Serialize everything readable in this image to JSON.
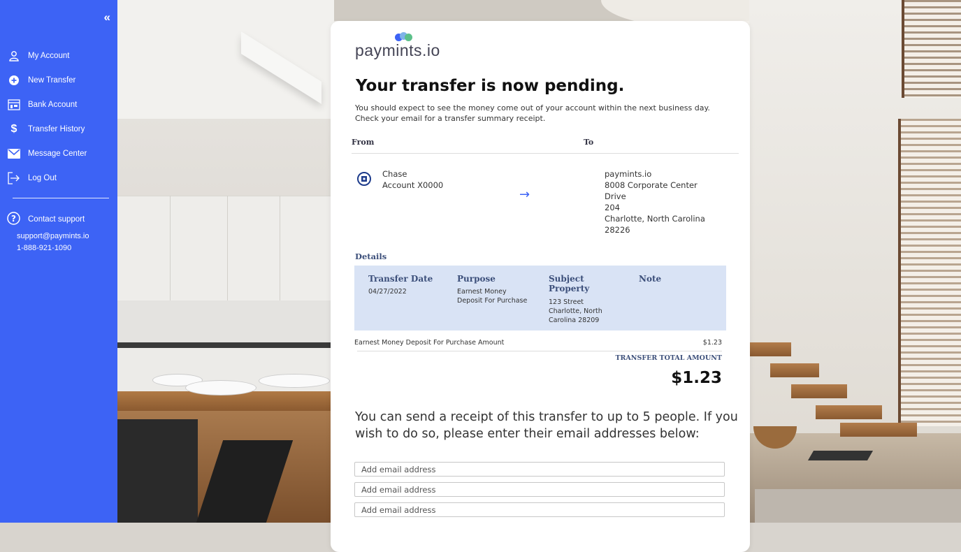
{
  "sidebar": {
    "collapse_label": "«",
    "items": [
      {
        "label": "My Account",
        "icon": "user-icon"
      },
      {
        "label": "New Transfer",
        "icon": "plus-circle-icon"
      },
      {
        "label": "Bank Account",
        "icon": "bank-icon"
      },
      {
        "label": "Transfer History",
        "icon": "dollar-icon"
      },
      {
        "label": "Message Center",
        "icon": "mail-icon"
      },
      {
        "label": "Log Out",
        "icon": "logout-icon"
      }
    ],
    "support": {
      "label": "Contact support",
      "icon": "question-circle-icon",
      "email": "support@paymints.io",
      "phone": "1-888-921-1090"
    },
    "bg_color": "#3d63f5"
  },
  "card": {
    "logo_text": "paymints.io",
    "headline": "Your transfer is now pending.",
    "subtext": "You should expect to see the money come out of your account within the next business day. Check your email for a transfer summary receipt.",
    "from_header": "From",
    "to_header": "To",
    "from": {
      "bank": "Chase",
      "account": "Account X0000",
      "icon": "chase-bank-icon"
    },
    "to": {
      "lines": [
        "paymints.io",
        "8008 Corporate Center",
        "Drive",
        "204",
        "Charlotte, North Carolina",
        "28226"
      ]
    },
    "details_header": "Details",
    "details": {
      "transfer_date_label": "Transfer Date",
      "transfer_date": "04/27/2022",
      "purpose_label": "Purpose",
      "purpose_lines": [
        "Earnest Money",
        "Deposit For Purchase"
      ],
      "subject_label_lines": [
        "Subject",
        "Property"
      ],
      "subject_lines": [
        "123 Street",
        "Charlotte, North",
        "Carolina 28209"
      ],
      "note_label": "Note"
    },
    "amount_label": "Earnest Money Deposit For Purchase Amount",
    "amount_value": "$1.23",
    "total_label": "TRANSFER TOTAL AMOUNT",
    "total_value": "$1.23",
    "receipt_text": "You can send a receipt of this transfer to up to 5 people. If you wish to do so, please enter their email addresses below:",
    "email_placeholder": "Add email address"
  }
}
